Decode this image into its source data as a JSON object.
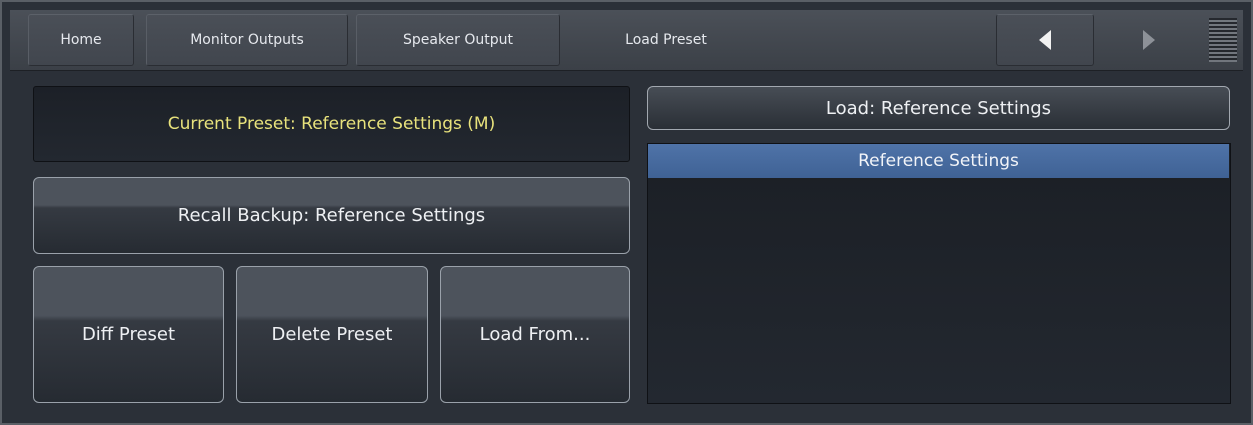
{
  "nav": {
    "tabs": [
      "Home",
      "Monitor Outputs",
      "Speaker Output",
      "Load Preset"
    ],
    "prev_icon": "triangle-left-icon",
    "next_icon": "triangle-right-icon",
    "menu_icon": "hamburger-menu-icon"
  },
  "preset": {
    "current_label": "Current Preset: Reference Settings (M)",
    "recall_label": "Recall Backup: Reference Settings",
    "diff_label": "Diff Preset",
    "delete_label": "Delete Preset",
    "load_from_label": "Load From...",
    "load_label": "Load: Reference Settings",
    "list": [
      "Reference Settings"
    ],
    "selected_index": 0
  },
  "colors": {
    "current_preset_text": "#e8e27c",
    "selected_row": "#4a6ea3"
  }
}
